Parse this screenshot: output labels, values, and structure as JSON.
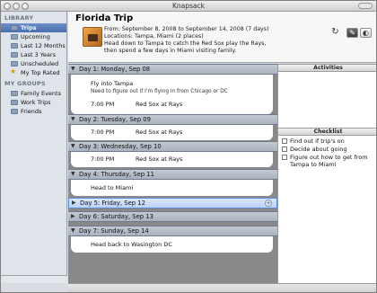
{
  "window": {
    "title": "Knapsack"
  },
  "sidebar": {
    "library_header": "LIBRARY",
    "library_items": [
      {
        "label": "Trips"
      },
      {
        "label": "Upcoming"
      },
      {
        "label": "Last 12 Months"
      },
      {
        "label": "Last 3 Years"
      },
      {
        "label": "Unscheduled"
      },
      {
        "label": "My Top Rated"
      }
    ],
    "groups_header": "MY GROUPS",
    "group_items": [
      {
        "label": "Family Events"
      },
      {
        "label": "Work Trips"
      },
      {
        "label": "Friends"
      }
    ]
  },
  "trip": {
    "title": "Florida Trip",
    "dates": "From:  September 8, 2008  to  September 14, 2008  (7 days)",
    "locations": "Locations: Tampa, Miami  (2 places)",
    "desc1": "Head down to Tampa to catch the Red Sox play the Rays,",
    "desc2": "then spend a few days in Miami visiting family."
  },
  "toolbar": {
    "refresh_icon": "refresh-icon",
    "edit_icon": "pencil-icon",
    "view_icon": "view-icon"
  },
  "days": [
    {
      "label": "Day 1:  Monday, Sep 08",
      "events": {
        "title": "Fly into Tampa",
        "note": "Need to figure out if I'm flying in from Chicago or DC",
        "time": "7:00 PM",
        "game": "Red Sox at Rays"
      }
    },
    {
      "label": "Day 2:  Tuesday, Sep 09",
      "events": {
        "time": "7:00 PM",
        "game": "Red Sox at Rays"
      }
    },
    {
      "label": "Day 3:  Wednesday, Sep 10",
      "events": {
        "time": "7:00 PM",
        "game": "Red Sox at Rays"
      }
    },
    {
      "label": "Day 4:  Thursday, Sep 11",
      "events": {
        "title": "Head to Miami"
      }
    },
    {
      "label": "Day 5:  Friday, Sep 12"
    },
    {
      "label": "Day 6:  Saturday, Sep 13"
    },
    {
      "label": "Day 7:  Sunday, Sep 14",
      "events": {
        "title": "Head back to Wasington DC"
      }
    }
  ],
  "activities": {
    "header": "Activities"
  },
  "checklist": {
    "header": "Checklist",
    "items": [
      {
        "line1": "Find out if trip's on",
        "line2": ""
      },
      {
        "line1": "Decide about going",
        "line2": ""
      },
      {
        "line1": "Figure out how to get from",
        "line2": "Tampa to Miami"
      }
    ]
  }
}
